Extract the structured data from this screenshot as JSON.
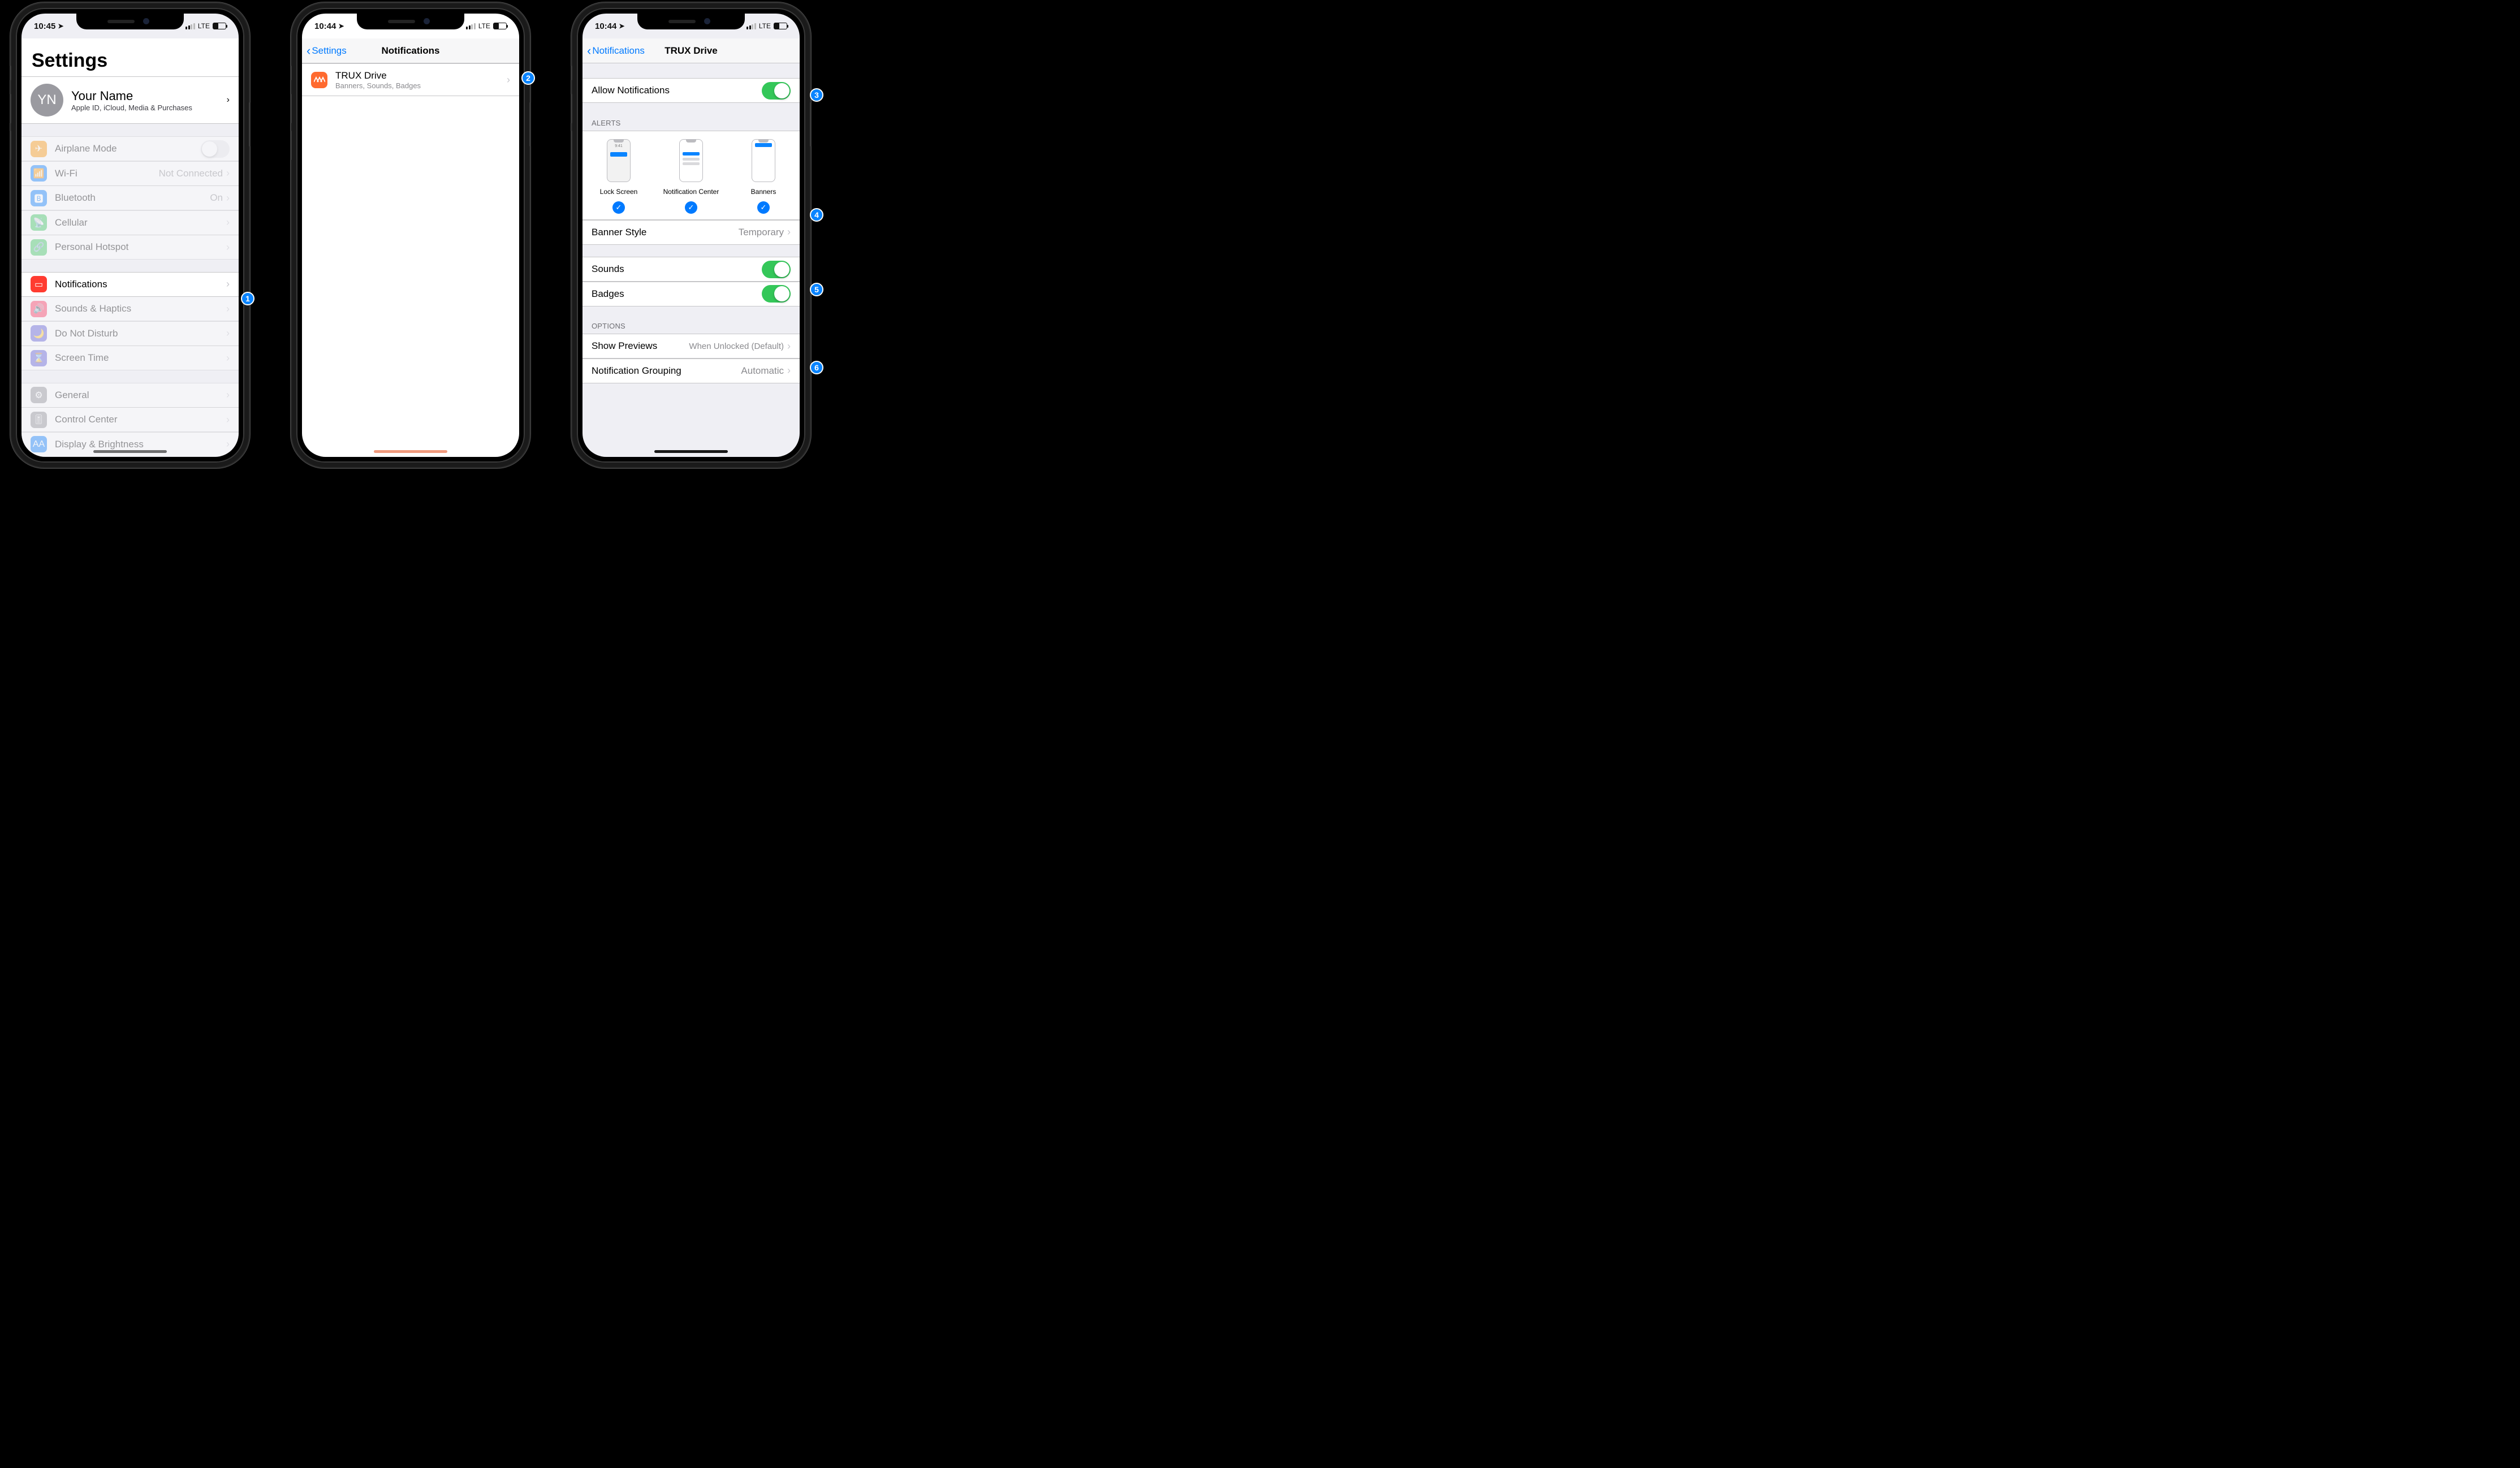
{
  "callouts": [
    "1",
    "2",
    "3",
    "4",
    "5",
    "6"
  ],
  "phone1": {
    "status": {
      "time": "10:45",
      "network": "LTE"
    },
    "title": "Settings",
    "profile": {
      "initials": "YN",
      "name": "Your Name",
      "subtitle": "Apple ID, iCloud, Media & Purchases"
    },
    "rows_group1": [
      {
        "label": "Airplane Mode",
        "value": "",
        "type": "switch",
        "on": false,
        "color": "#ff9500",
        "glyph": "✈"
      },
      {
        "label": "Wi-Fi",
        "value": "Not Connected",
        "type": "link",
        "color": "#007aff",
        "glyph": "📶"
      },
      {
        "label": "Bluetooth",
        "value": "On",
        "type": "link",
        "color": "#007aff",
        "glyph": "🅱"
      },
      {
        "label": "Cellular",
        "value": "",
        "type": "link",
        "color": "#34c759",
        "glyph": "📡"
      },
      {
        "label": "Personal Hotspot",
        "value": "",
        "type": "link",
        "color": "#34c759",
        "glyph": "🔗"
      }
    ],
    "highlight": {
      "label": "Notifications",
      "color": "#ff3b30",
      "glyph": "🔔"
    },
    "rows_group2": [
      {
        "label": "Sounds & Haptics",
        "color": "#ff2d55",
        "glyph": "🔊"
      },
      {
        "label": "Do Not Disturb",
        "color": "#5856d6",
        "glyph": "🌙"
      },
      {
        "label": "Screen Time",
        "color": "#5856d6",
        "glyph": "⌛"
      }
    ],
    "rows_group3": [
      {
        "label": "General",
        "color": "#8e8e93",
        "glyph": "⚙"
      },
      {
        "label": "Control Center",
        "color": "#8e8e93",
        "glyph": "🎚"
      },
      {
        "label": "Display & Brightness",
        "color": "#007aff",
        "glyph": "AA"
      }
    ]
  },
  "phone2": {
    "status": {
      "time": "10:44",
      "network": "LTE"
    },
    "back": "Settings",
    "title": "Notifications",
    "app_row": {
      "name": "TRUX Drive",
      "subtitle": "Banners, Sounds, Badges",
      "icon_color": "#ff6a2f"
    }
  },
  "phone3": {
    "status": {
      "time": "10:44",
      "network": "LTE"
    },
    "back": "Notifications",
    "title": "TRUX Drive",
    "allow": {
      "label": "Allow Notifications",
      "on": true
    },
    "alerts_header": "ALERTS",
    "alerts": {
      "lock": {
        "label": "Lock Screen",
        "checked": true
      },
      "center": {
        "label": "Notification Center",
        "checked": true
      },
      "banners": {
        "label": "Banners",
        "checked": true
      }
    },
    "banner_style": {
      "label": "Banner Style",
      "value": "Temporary"
    },
    "sounds": {
      "label": "Sounds",
      "on": true
    },
    "badges": {
      "label": "Badges",
      "on": true
    },
    "options_header": "OPTIONS",
    "show_previews": {
      "label": "Show Previews",
      "value": "When Unlocked (Default)"
    },
    "grouping": {
      "label": "Notification Grouping",
      "value": "Automatic"
    }
  }
}
